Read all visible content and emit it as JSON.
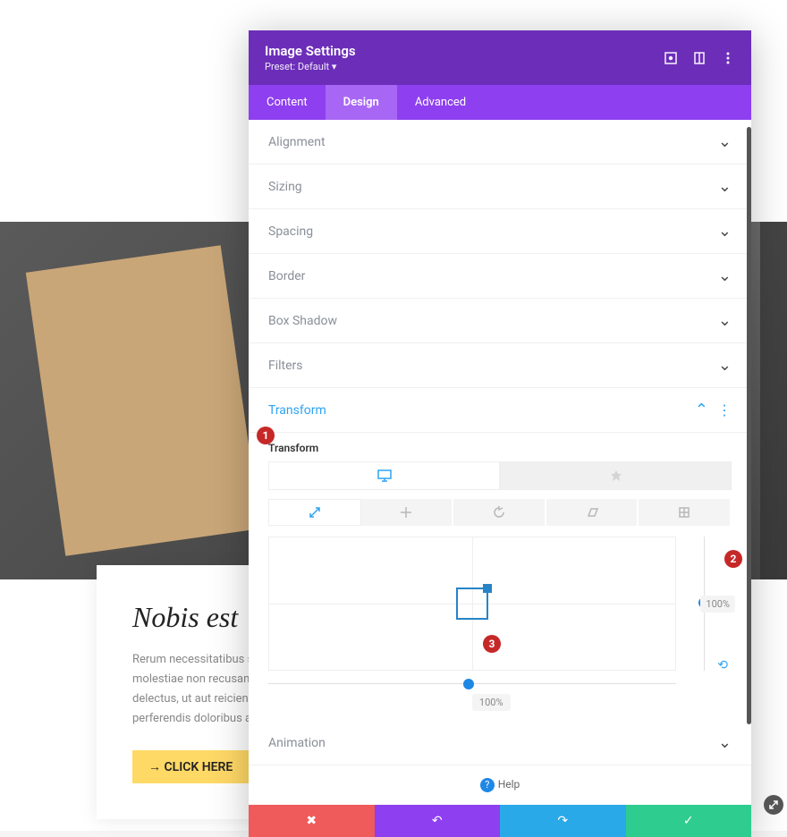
{
  "page": {
    "card_title": "Nobis est",
    "card_text": "Rerum necessitatibus saepe eveniet ut et voluptates repudiandae sint et molestiae non recusandae. Itaque earum rerum hic tenetur a sapiente delectus, ut aut reiciendis voluptatibus maiores alias consequatur aut perferendis doloribus asperiores repellat.",
    "card_button": "→ CLICK HERE"
  },
  "modal": {
    "title": "Image Settings",
    "preset": "Preset: Default ▾",
    "tabs": {
      "content": "Content",
      "design": "Design",
      "advanced": "Advanced"
    },
    "sections": {
      "alignment": "Alignment",
      "sizing": "Sizing",
      "spacing": "Spacing",
      "border": "Border",
      "box_shadow": "Box Shadow",
      "filters": "Filters",
      "transform": "Transform",
      "animation": "Animation"
    },
    "transform": {
      "sub_label": "Transform",
      "x_value": "100%",
      "y_value": "100%"
    },
    "help": "Help"
  },
  "annotations": {
    "a1": "1",
    "a2": "2",
    "a3": "3"
  }
}
